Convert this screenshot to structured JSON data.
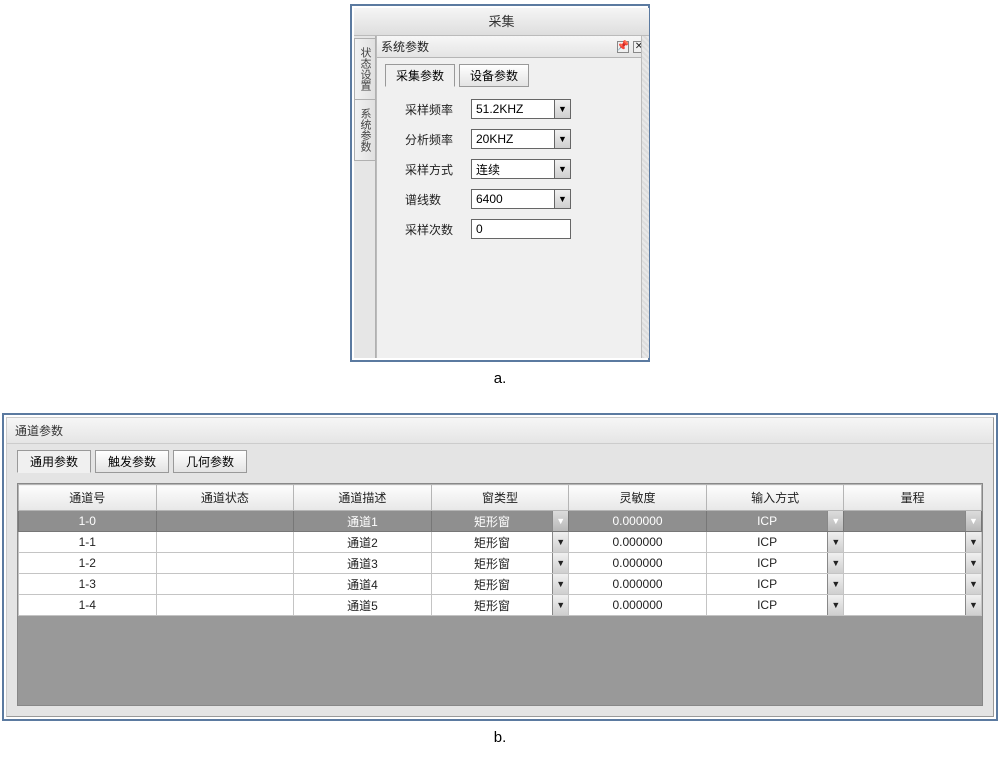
{
  "panelA": {
    "window_title": "采集",
    "panel_title": "系统参数",
    "side_tabs": {
      "status": "状态设置",
      "system": "系统参数"
    },
    "tabs": {
      "collect": "采集参数",
      "device": "设备参数"
    },
    "fields": {
      "sample_freq": {
        "label": "采样频率",
        "value": "51.2KHZ",
        "type": "combo"
      },
      "analysis_freq": {
        "label": "分析频率",
        "value": "20KHZ",
        "type": "combo"
      },
      "sample_mode": {
        "label": "采样方式",
        "value": "连续",
        "type": "combo"
      },
      "spectral_lines": {
        "label": "谱线数",
        "value": "6400",
        "type": "combo"
      },
      "sample_count": {
        "label": "采样次数",
        "value": "0",
        "type": "text"
      }
    }
  },
  "captions": {
    "a": "a.",
    "b": "b."
  },
  "panelB": {
    "panel_title": "通道参数",
    "tabs": {
      "general": "通用参数",
      "trigger": "触发参数",
      "geometry": "几何参数"
    },
    "columns": {
      "ch_no": "通道号",
      "ch_state": "通道状态",
      "ch_desc": "通道描述",
      "win_type": "窗类型",
      "sens": "灵敏度",
      "in_mode": "输入方式",
      "range": "量程"
    },
    "column_has_arrow": {
      "ch_no": false,
      "ch_state": false,
      "ch_desc": false,
      "win_type": true,
      "sens": false,
      "in_mode": true,
      "range": true
    },
    "rows": [
      {
        "selected": true,
        "ch_no": "1-0",
        "ch_state": "",
        "ch_desc": "通道1",
        "win_type": "矩形窗",
        "sens": "0.000000",
        "in_mode": "ICP",
        "range": ""
      },
      {
        "selected": false,
        "ch_no": "1-1",
        "ch_state": "",
        "ch_desc": "通道2",
        "win_type": "矩形窗",
        "sens": "0.000000",
        "in_mode": "ICP",
        "range": ""
      },
      {
        "selected": false,
        "ch_no": "1-2",
        "ch_state": "",
        "ch_desc": "通道3",
        "win_type": "矩形窗",
        "sens": "0.000000",
        "in_mode": "ICP",
        "range": ""
      },
      {
        "selected": false,
        "ch_no": "1-3",
        "ch_state": "",
        "ch_desc": "通道4",
        "win_type": "矩形窗",
        "sens": "0.000000",
        "in_mode": "ICP",
        "range": ""
      },
      {
        "selected": false,
        "ch_no": "1-4",
        "ch_state": "",
        "ch_desc": "通道5",
        "win_type": "矩形窗",
        "sens": "0.000000",
        "in_mode": "ICP",
        "range": ""
      }
    ]
  }
}
